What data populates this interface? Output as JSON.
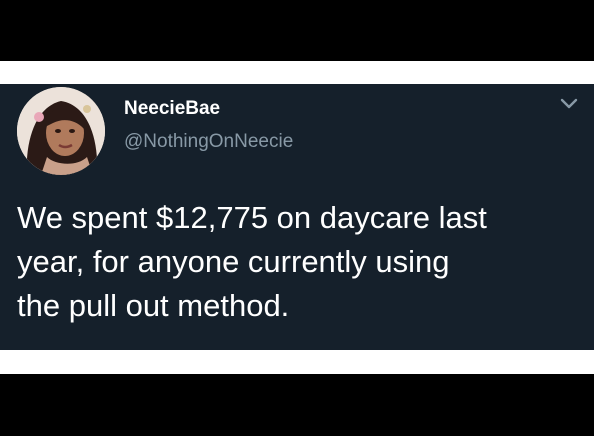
{
  "tweet": {
    "display_name": "NeecieBae",
    "handle": "@NothingOnNeecie",
    "text": "We spent $12,775 on daycare last\nyear, for anyone currently using\nthe pull out method.",
    "avatar_icon": "profile-photo",
    "menu_icon": "chevron-down-icon"
  },
  "colors": {
    "tweet_background": "#15202b",
    "handle_gray": "#8899a6",
    "frame_black": "#000000",
    "band_white": "#ffffff"
  }
}
